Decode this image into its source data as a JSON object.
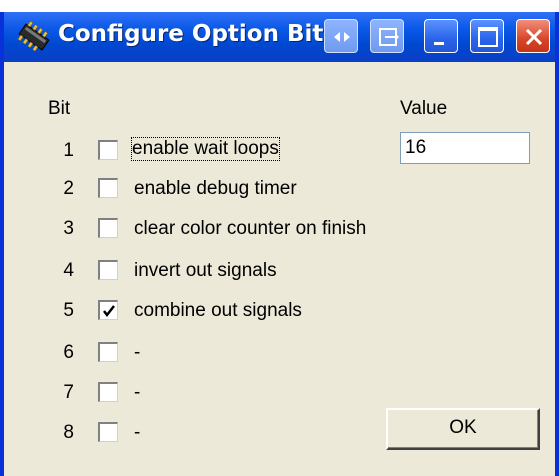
{
  "window": {
    "title": "Configure Option Bits",
    "icons": {
      "app": "chip-icon",
      "extra1": "resize-arrows-icon",
      "extra2": "move-to-tray-icon",
      "minimize": "minimize-icon",
      "maximize": "maximize-icon",
      "close": "close-icon"
    }
  },
  "form": {
    "bit_header": "Bit",
    "value_header": "Value",
    "value": "16",
    "ok_label": "OK",
    "options": [
      {
        "bit": "1",
        "label": "enable wait loops",
        "checked": false
      },
      {
        "bit": "2",
        "label": "enable debug timer",
        "checked": false
      },
      {
        "bit": "3",
        "label": "clear color counter on finish",
        "checked": false
      },
      {
        "bit": "4",
        "label": "invert out signals",
        "checked": false
      },
      {
        "bit": "5",
        "label": "combine out signals",
        "checked": true
      },
      {
        "bit": "6",
        "label": "-",
        "checked": false
      },
      {
        "bit": "7",
        "label": "-",
        "checked": false
      },
      {
        "bit": "8",
        "label": "-",
        "checked": false
      }
    ]
  }
}
